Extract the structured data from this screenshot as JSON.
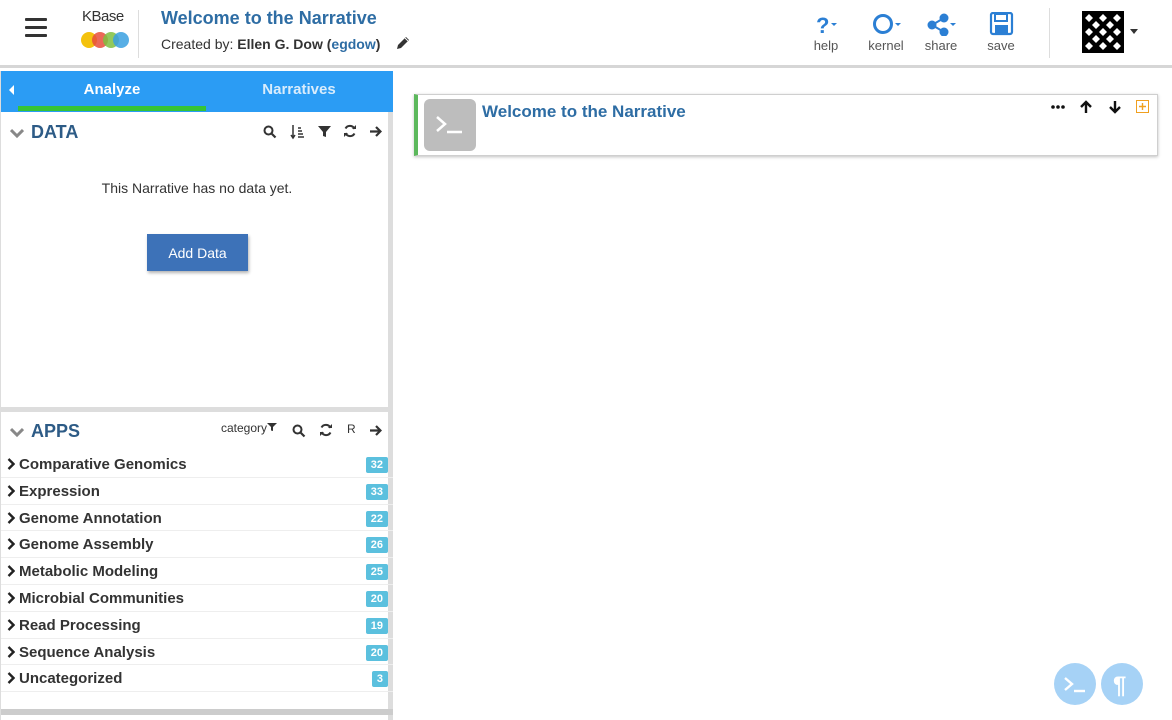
{
  "header": {
    "logo_text": "KBase",
    "title": "Welcome to the Narrative",
    "created_prefix": "Created by: ",
    "author": "Ellen G. Dow",
    "open_paren": " (",
    "username": "egdow",
    "close_paren": ")",
    "buttons": [
      {
        "label": "help",
        "icon": "question-icon"
      },
      {
        "label": "kernel",
        "icon": "circle-icon"
      },
      {
        "label": "share",
        "icon": "share-icon"
      },
      {
        "label": "save",
        "icon": "floppy-icon"
      }
    ],
    "accent_color": "#2e6da4"
  },
  "sidebar": {
    "tabs": [
      {
        "label": "Analyze",
        "active": true
      },
      {
        "label": "Narratives",
        "active": false
      }
    ],
    "data": {
      "title": "DATA",
      "empty_text": "This Narrative has no data yet.",
      "add_button": "Add Data"
    },
    "apps": {
      "title": "APPS",
      "filter_label": "category",
      "r_label": "R",
      "categories": [
        {
          "name": "Comparative Genomics",
          "count": "32"
        },
        {
          "name": "Expression",
          "count": "33"
        },
        {
          "name": "Genome Annotation",
          "count": "22"
        },
        {
          "name": "Genome Assembly",
          "count": "26"
        },
        {
          "name": "Metabolic Modeling",
          "count": "25"
        },
        {
          "name": "Microbial Communities",
          "count": "20"
        },
        {
          "name": "Read Processing",
          "count": "19"
        },
        {
          "name": "Sequence Analysis",
          "count": "20"
        },
        {
          "name": "Uncategorized",
          "count": "3"
        }
      ]
    },
    "tab_color": "#2b9cf4",
    "active_underline_color": "#36c436"
  },
  "main": {
    "cell_title": "Welcome to the Narrative",
    "cell_border_color": "#5cb85c"
  }
}
